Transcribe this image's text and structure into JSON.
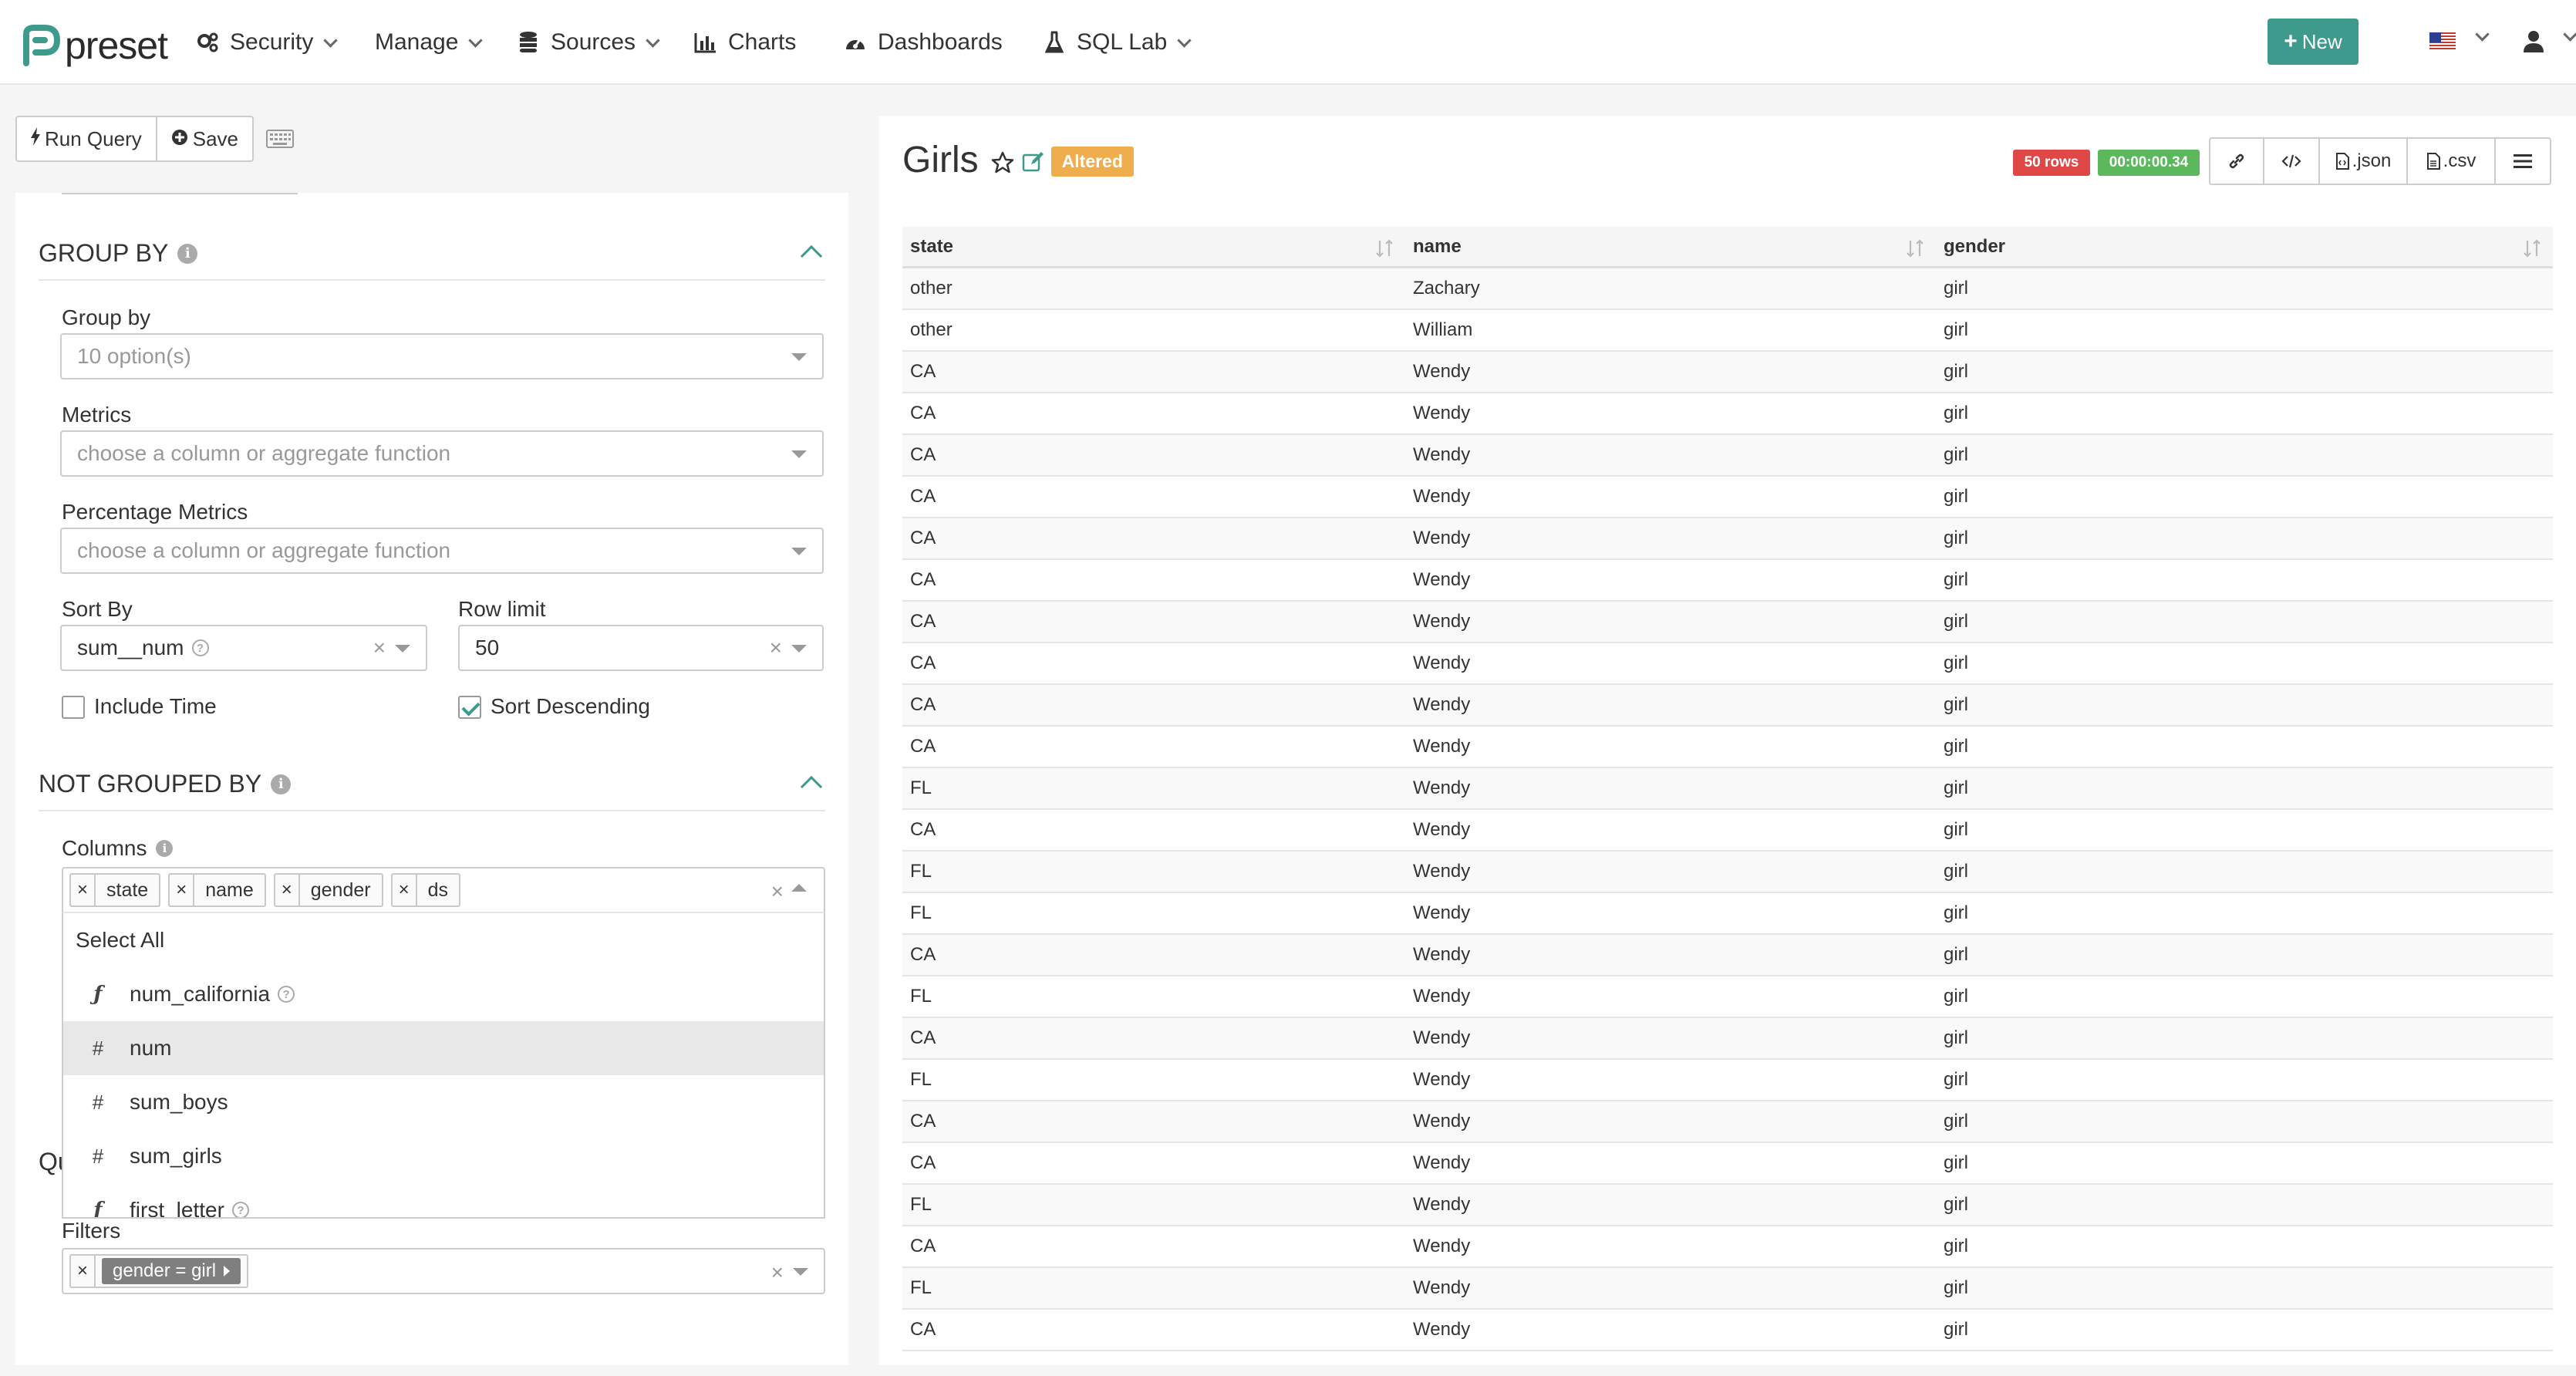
{
  "app": {
    "logo_text": "preset"
  },
  "nav": {
    "items": [
      {
        "label": "Security",
        "icon": "gears-icon",
        "dropdown": true
      },
      {
        "label": "Manage",
        "icon": "",
        "dropdown": true
      },
      {
        "label": "Sources",
        "icon": "database-icon",
        "dropdown": true
      },
      {
        "label": "Charts",
        "icon": "bar-chart-icon",
        "dropdown": false
      },
      {
        "label": "Dashboards",
        "icon": "dashboard-gauge-icon",
        "dropdown": false
      },
      {
        "label": "SQL Lab",
        "icon": "flask-icon",
        "dropdown": true
      }
    ],
    "new_button": "New",
    "locale_icon": "us-flag-icon",
    "user_icon": "user-icon",
    "accent_color": "#3e9a8d"
  },
  "toolbar": {
    "run_query": "Run Query",
    "save": "Save"
  },
  "group_by_section": {
    "title": "GROUP BY",
    "group_by": {
      "label": "Group by",
      "placeholder": "10 option(s)"
    },
    "metrics": {
      "label": "Metrics",
      "placeholder": "choose a column or aggregate function"
    },
    "percentage_metrics": {
      "label": "Percentage Metrics",
      "placeholder": "choose a column or aggregate function"
    },
    "sort_by": {
      "label": "Sort By",
      "value": "sum__num"
    },
    "row_limit": {
      "label": "Row limit",
      "value": "50"
    },
    "include_time": {
      "label": "Include Time",
      "checked": false
    },
    "sort_descending": {
      "label": "Sort Descending",
      "checked": true
    }
  },
  "not_grouped_section": {
    "title": "NOT GROUPED BY",
    "columns_label": "Columns",
    "selected": [
      "state",
      "name",
      "gender",
      "ds"
    ],
    "dropdown": {
      "select_all": "Select All",
      "options": [
        {
          "type": "ƒ",
          "name": "num_california",
          "help": true,
          "highlighted": false
        },
        {
          "type": "#",
          "name": "num",
          "help": false,
          "highlighted": true
        },
        {
          "type": "#",
          "name": "sum_boys",
          "help": false,
          "highlighted": false
        },
        {
          "type": "#",
          "name": "sum_girls",
          "help": false,
          "highlighted": false
        },
        {
          "type": "ƒ",
          "name": "first_letter",
          "help": true,
          "highlighted": false
        }
      ]
    }
  },
  "query_section": {
    "title_partial": "Qu",
    "filters_label": "Filters",
    "filter_tag": "gender = girl"
  },
  "chart": {
    "title": "Girls",
    "altered": "Altered",
    "rows_badge": "50 rows",
    "time_badge": "00:00:00.34",
    "actions": {
      "json": ".json",
      "csv": ".csv"
    },
    "columns": [
      "state",
      "name",
      "gender"
    ],
    "rows": [
      [
        "other",
        "Zachary",
        "girl"
      ],
      [
        "other",
        "William",
        "girl"
      ],
      [
        "CA",
        "Wendy",
        "girl"
      ],
      [
        "CA",
        "Wendy",
        "girl"
      ],
      [
        "CA",
        "Wendy",
        "girl"
      ],
      [
        "CA",
        "Wendy",
        "girl"
      ],
      [
        "CA",
        "Wendy",
        "girl"
      ],
      [
        "CA",
        "Wendy",
        "girl"
      ],
      [
        "CA",
        "Wendy",
        "girl"
      ],
      [
        "CA",
        "Wendy",
        "girl"
      ],
      [
        "CA",
        "Wendy",
        "girl"
      ],
      [
        "CA",
        "Wendy",
        "girl"
      ],
      [
        "FL",
        "Wendy",
        "girl"
      ],
      [
        "CA",
        "Wendy",
        "girl"
      ],
      [
        "FL",
        "Wendy",
        "girl"
      ],
      [
        "FL",
        "Wendy",
        "girl"
      ],
      [
        "CA",
        "Wendy",
        "girl"
      ],
      [
        "FL",
        "Wendy",
        "girl"
      ],
      [
        "CA",
        "Wendy",
        "girl"
      ],
      [
        "FL",
        "Wendy",
        "girl"
      ],
      [
        "CA",
        "Wendy",
        "girl"
      ],
      [
        "CA",
        "Wendy",
        "girl"
      ],
      [
        "FL",
        "Wendy",
        "girl"
      ],
      [
        "CA",
        "Wendy",
        "girl"
      ],
      [
        "FL",
        "Wendy",
        "girl"
      ],
      [
        "CA",
        "Wendy",
        "girl"
      ]
    ]
  }
}
